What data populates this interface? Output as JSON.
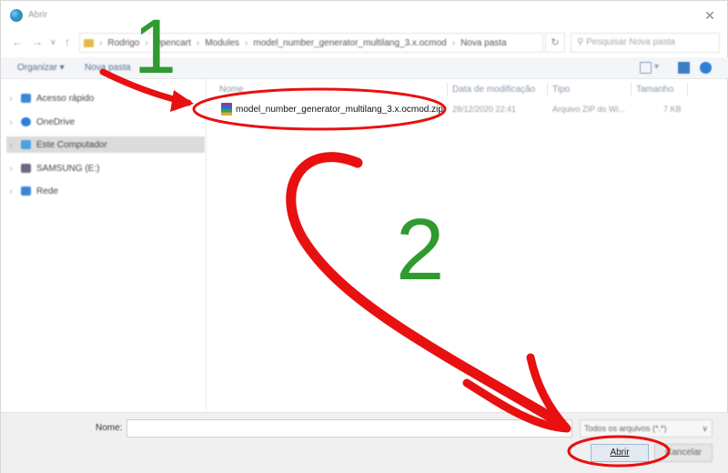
{
  "dialog": {
    "title": "Abrir",
    "accent": "#e81010",
    "step_color": "#2f9a2f"
  },
  "address": {
    "breadcrumbs": [
      "Rodrigo",
      "Opencart",
      "Modules",
      "model_number_generator_multilang_3.x.ocmod",
      "Nova pasta"
    ],
    "search_placeholder": "Pesquisar Nova pasta"
  },
  "toolbar": {
    "organize_label": "Organizar ▾",
    "new_folder_label": "Nova pasta"
  },
  "sidebar": {
    "items": [
      {
        "label": "Acesso rápido",
        "icon": "star-icon",
        "color": "#3a86d8",
        "selected": false
      },
      {
        "label": "OneDrive",
        "icon": "cloud-icon",
        "color": "#2b7fd6",
        "selected": false
      },
      {
        "label": "Este Computador",
        "icon": "computer-icon",
        "color": "#4aa3e0",
        "selected": true
      },
      {
        "label": "SAMSUNG (E:)",
        "icon": "drive-icon",
        "color": "#6a6a80",
        "selected": false
      },
      {
        "label": "Rede",
        "icon": "network-icon",
        "color": "#3a86d8",
        "selected": false
      }
    ]
  },
  "columns": {
    "name": "Nome",
    "date": "Data de modificação",
    "type": "Tipo",
    "size": "Tamanho"
  },
  "files": [
    {
      "name": "model_number_generator_multilang_3.x.ocmod.zip",
      "date": "28/12/2020 22:41",
      "type": "Arquivo ZIP do Wi...",
      "size": "7 KB",
      "icon": "zip-archive-icon"
    }
  ],
  "footer": {
    "name_label": "Nome:",
    "name_value": "",
    "file_type": "Todos os arquivos (*.*)",
    "open_label": "Abrir",
    "cancel_label": "Cancelar"
  },
  "annotations": {
    "step1": "1",
    "step2": "2"
  }
}
